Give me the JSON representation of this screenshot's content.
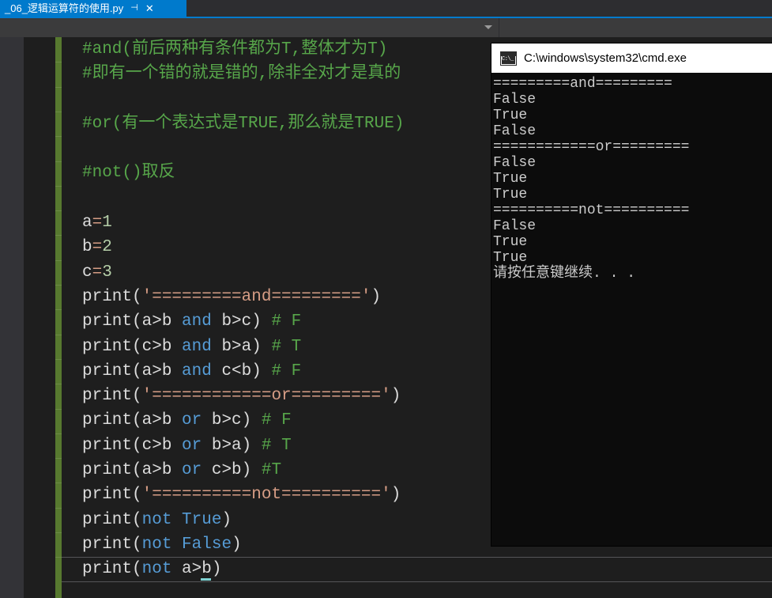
{
  "tab": {
    "title": "_06_逻辑运算符的使用.py",
    "pin_label": "⊣",
    "close_label": "✕"
  },
  "navbar": {
    "left_value": "",
    "right_value": "",
    "caret_icon": "chevron-down-icon"
  },
  "editor": {
    "lines": [
      {
        "tokens": [
          {
            "t": "#and(前后两种有条件都为T,整体才为T)",
            "c": "tok-comment"
          }
        ]
      },
      {
        "tokens": [
          {
            "t": "#即有一个错的就是错的,除非全对才是真的",
            "c": "tok-comment"
          }
        ]
      },
      {
        "tokens": []
      },
      {
        "tokens": [
          {
            "t": "#or(有一个表达式是TRUE,那么就是TRUE)",
            "c": "tok-comment"
          }
        ]
      },
      {
        "tokens": []
      },
      {
        "tokens": [
          {
            "t": "#not()取反",
            "c": "tok-comment"
          }
        ]
      },
      {
        "tokens": []
      },
      {
        "tokens": [
          {
            "t": "a",
            "c": "tok-plain"
          },
          {
            "t": "=",
            "c": "tok-op"
          },
          {
            "t": "1",
            "c": "tok-num"
          }
        ]
      },
      {
        "tokens": [
          {
            "t": "b",
            "c": "tok-plain"
          },
          {
            "t": "=",
            "c": "tok-op"
          },
          {
            "t": "2",
            "c": "tok-num"
          }
        ]
      },
      {
        "tokens": [
          {
            "t": "c",
            "c": "tok-plain"
          },
          {
            "t": "=",
            "c": "tok-op"
          },
          {
            "t": "3",
            "c": "tok-num"
          }
        ]
      },
      {
        "tokens": [
          {
            "t": "print(",
            "c": "tok-fn"
          },
          {
            "t": "'=========and========='",
            "c": "tok-str"
          },
          {
            "t": ")",
            "c": "tok-fn"
          }
        ]
      },
      {
        "tokens": [
          {
            "t": "print(a>b ",
            "c": "tok-fn"
          },
          {
            "t": "and",
            "c": "tok-kw"
          },
          {
            "t": " b>c) ",
            "c": "tok-fn"
          },
          {
            "t": "# F",
            "c": "tok-comment"
          }
        ]
      },
      {
        "tokens": [
          {
            "t": "print(c>b ",
            "c": "tok-fn"
          },
          {
            "t": "and",
            "c": "tok-kw"
          },
          {
            "t": " b>a) ",
            "c": "tok-fn"
          },
          {
            "t": "# T",
            "c": "tok-comment"
          }
        ]
      },
      {
        "tokens": [
          {
            "t": "print(a>b ",
            "c": "tok-fn"
          },
          {
            "t": "and",
            "c": "tok-kw"
          },
          {
            "t": " c<b) ",
            "c": "tok-fn"
          },
          {
            "t": "# F",
            "c": "tok-comment"
          }
        ]
      },
      {
        "tokens": [
          {
            "t": "print(",
            "c": "tok-fn"
          },
          {
            "t": "'============or========='",
            "c": "tok-str"
          },
          {
            "t": ")",
            "c": "tok-fn"
          }
        ]
      },
      {
        "tokens": [
          {
            "t": "print(a>b ",
            "c": "tok-fn"
          },
          {
            "t": "or",
            "c": "tok-kw"
          },
          {
            "t": " b>c) ",
            "c": "tok-fn"
          },
          {
            "t": "# F",
            "c": "tok-comment"
          }
        ]
      },
      {
        "tokens": [
          {
            "t": "print(c>b ",
            "c": "tok-fn"
          },
          {
            "t": "or",
            "c": "tok-kw"
          },
          {
            "t": " b>a) ",
            "c": "tok-fn"
          },
          {
            "t": "# T",
            "c": "tok-comment"
          }
        ]
      },
      {
        "tokens": [
          {
            "t": "print(a>b ",
            "c": "tok-fn"
          },
          {
            "t": "or",
            "c": "tok-kw"
          },
          {
            "t": " c>b) ",
            "c": "tok-fn"
          },
          {
            "t": "#T",
            "c": "tok-comment"
          }
        ]
      },
      {
        "tokens": [
          {
            "t": "print(",
            "c": "tok-fn"
          },
          {
            "t": "'==========not=========='",
            "c": "tok-str"
          },
          {
            "t": ")",
            "c": "tok-fn"
          }
        ]
      },
      {
        "tokens": [
          {
            "t": "print(",
            "c": "tok-fn"
          },
          {
            "t": "not",
            "c": "tok-kw"
          },
          {
            "t": " ",
            "c": "tok-fn"
          },
          {
            "t": "True",
            "c": "tok-kw"
          },
          {
            "t": ")",
            "c": "tok-fn"
          }
        ]
      },
      {
        "tokens": [
          {
            "t": "print(",
            "c": "tok-fn"
          },
          {
            "t": "not",
            "c": "tok-kw"
          },
          {
            "t": " ",
            "c": "tok-fn"
          },
          {
            "t": "False",
            "c": "tok-kw"
          },
          {
            "t": ")",
            "c": "tok-fn"
          }
        ]
      },
      {
        "current": true,
        "tokens": [
          {
            "t": "print(",
            "c": "tok-fn"
          },
          {
            "t": "not",
            "c": "tok-kw"
          },
          {
            "t": " a>b)",
            "c": "tok-fn"
          }
        ]
      }
    ]
  },
  "console": {
    "title": "C:\\windows\\system32\\cmd.exe",
    "icon": "cmd-icon",
    "output": [
      "=========and=========",
      "False",
      "True",
      "False",
      "============or=========",
      "False",
      "True",
      "True",
      "==========not==========",
      "False",
      "True",
      "True",
      "请按任意键继续. . ."
    ]
  },
  "colors": {
    "accent": "#007acc",
    "editor_bg": "#1e1e1e",
    "margin_bg": "#333337",
    "change_bar": "#57792f",
    "comment": "#57a64a",
    "string": "#d69d85",
    "keyword": "#569cd6",
    "number": "#b5cea8",
    "console_bg": "#0c0c0c"
  }
}
